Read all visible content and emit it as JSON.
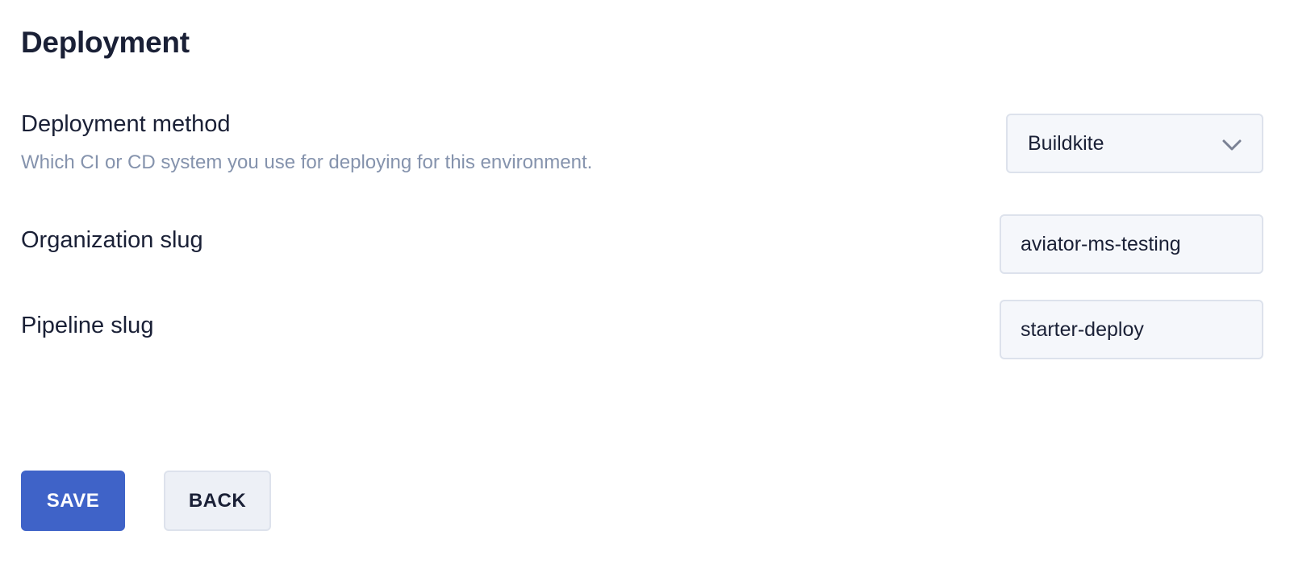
{
  "page": {
    "title": "Deployment"
  },
  "fields": {
    "deployment_method": {
      "label": "Deployment method",
      "help": "Which CI or CD system you use for deploying for this environment.",
      "selected": "Buildkite"
    },
    "organization_slug": {
      "label": "Organization slug",
      "value": "aviator-ms-testing"
    },
    "pipeline_slug": {
      "label": "Pipeline slug",
      "value": "starter-deploy"
    }
  },
  "actions": {
    "save_label": "SAVE",
    "back_label": "BACK"
  },
  "icons": {
    "select_indicator": "chevron-down-icon"
  },
  "colors": {
    "primary": "#3f63c8",
    "text": "#1a2036",
    "muted": "#8593ad",
    "input_bg": "#f5f7fb",
    "border": "#dde2ec"
  }
}
